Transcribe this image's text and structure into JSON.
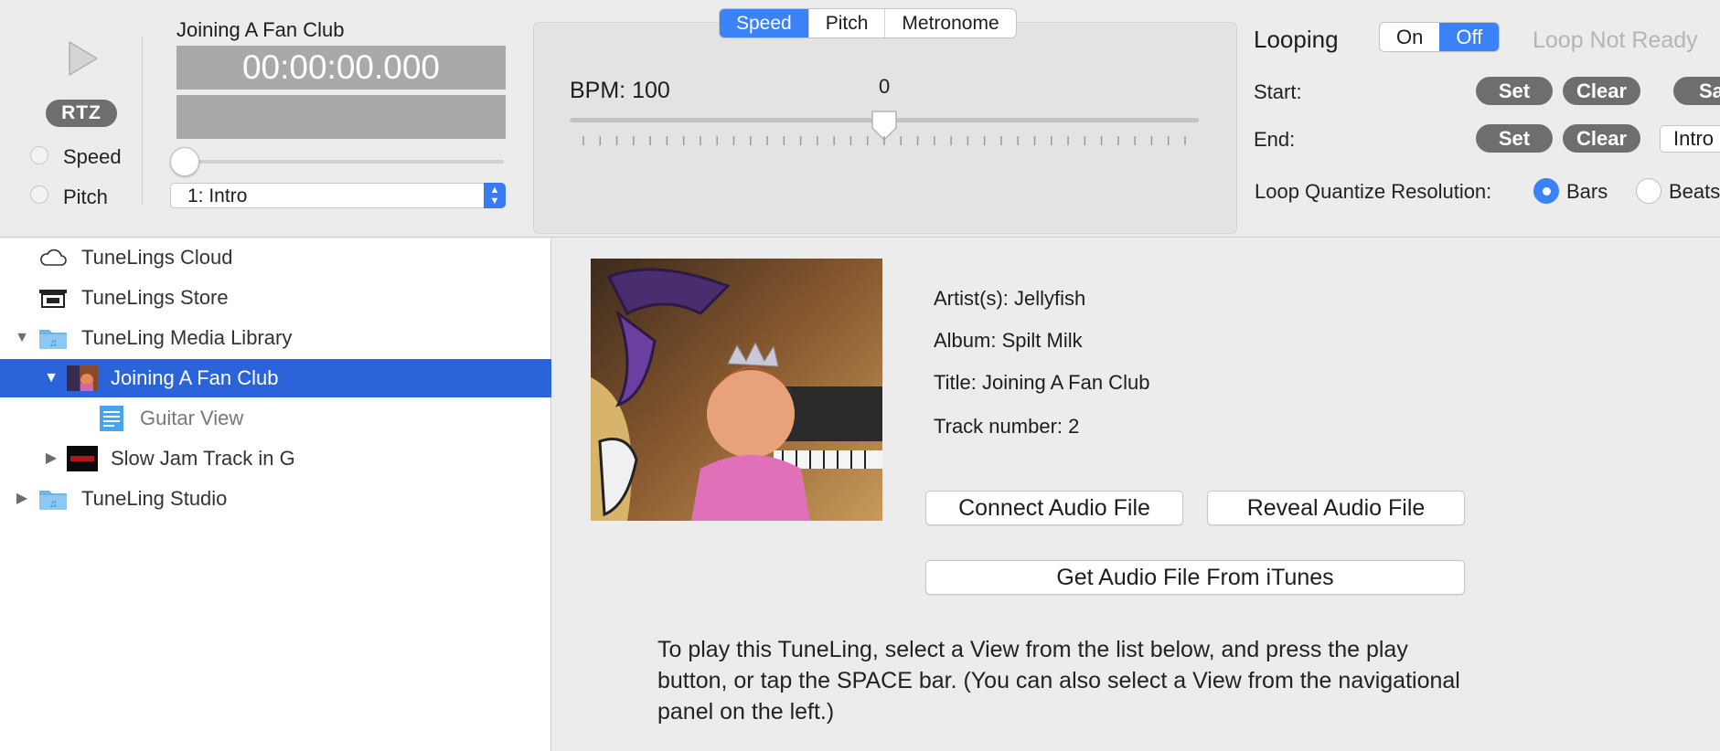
{
  "transport": {
    "rtz_label": "RTZ",
    "speed_label": "Speed",
    "pitch_label": "Pitch",
    "track_title": "Joining A Fan Club",
    "time": "00:00:00.000",
    "section_select": "1: Intro"
  },
  "speed_panel": {
    "tabs": [
      "Speed",
      "Pitch",
      "Metronome"
    ],
    "active_tab": "Speed",
    "bpm_label": "BPM: 100",
    "slider_value": "0",
    "slider_position": 0.5
  },
  "looping": {
    "label": "Looping",
    "on_label": "On",
    "off_label": "Off",
    "status": "Loop Not Ready",
    "start_label": "Start:",
    "end_label": "End:",
    "set_label": "Set",
    "clear_label": "Clear",
    "save_label_partial": "Sa",
    "end_section": "Intro",
    "quantize_label": "Loop Quantize Resolution:",
    "bars_label": "Bars",
    "beats_label": "Beats",
    "quantize_selected": "Bars"
  },
  "sidebar": {
    "items": [
      {
        "label": "TuneLings Cloud",
        "icon": "cloud-icon"
      },
      {
        "label": "TuneLings Store",
        "icon": "store-icon"
      },
      {
        "label": "TuneLing Media Library",
        "icon": "music-folder-icon",
        "expanded": true
      },
      {
        "label": "Joining A Fan Club",
        "icon": "album-art-icon",
        "expanded": true,
        "selected": true
      },
      {
        "label": "Guitar View",
        "icon": "document-icon"
      },
      {
        "label": "Slow Jam Track in G",
        "icon": "album-art-icon",
        "expanded": false
      },
      {
        "label": "TuneLing Studio",
        "icon": "music-folder-icon",
        "expanded": false
      }
    ]
  },
  "main": {
    "artist": "Artist(s): Jellyfish",
    "album": "Album: Spilt Milk",
    "title": "Title: Joining A Fan Club",
    "track": "Track number: 2",
    "connect_button": "Connect Audio File",
    "reveal_button": "Reveal Audio File",
    "itunes_button": "Get Audio File From iTunes",
    "instructions": "To play this TuneLing, select a View from the list below, and press the play button, or tap the SPACE bar. (You can also select a View from the navigational panel on the left.)"
  },
  "colors": {
    "accent": "#3b82f6",
    "selection": "#2b64d8",
    "pill": "#6e6e6e",
    "time_box": "#a9a9a9"
  }
}
